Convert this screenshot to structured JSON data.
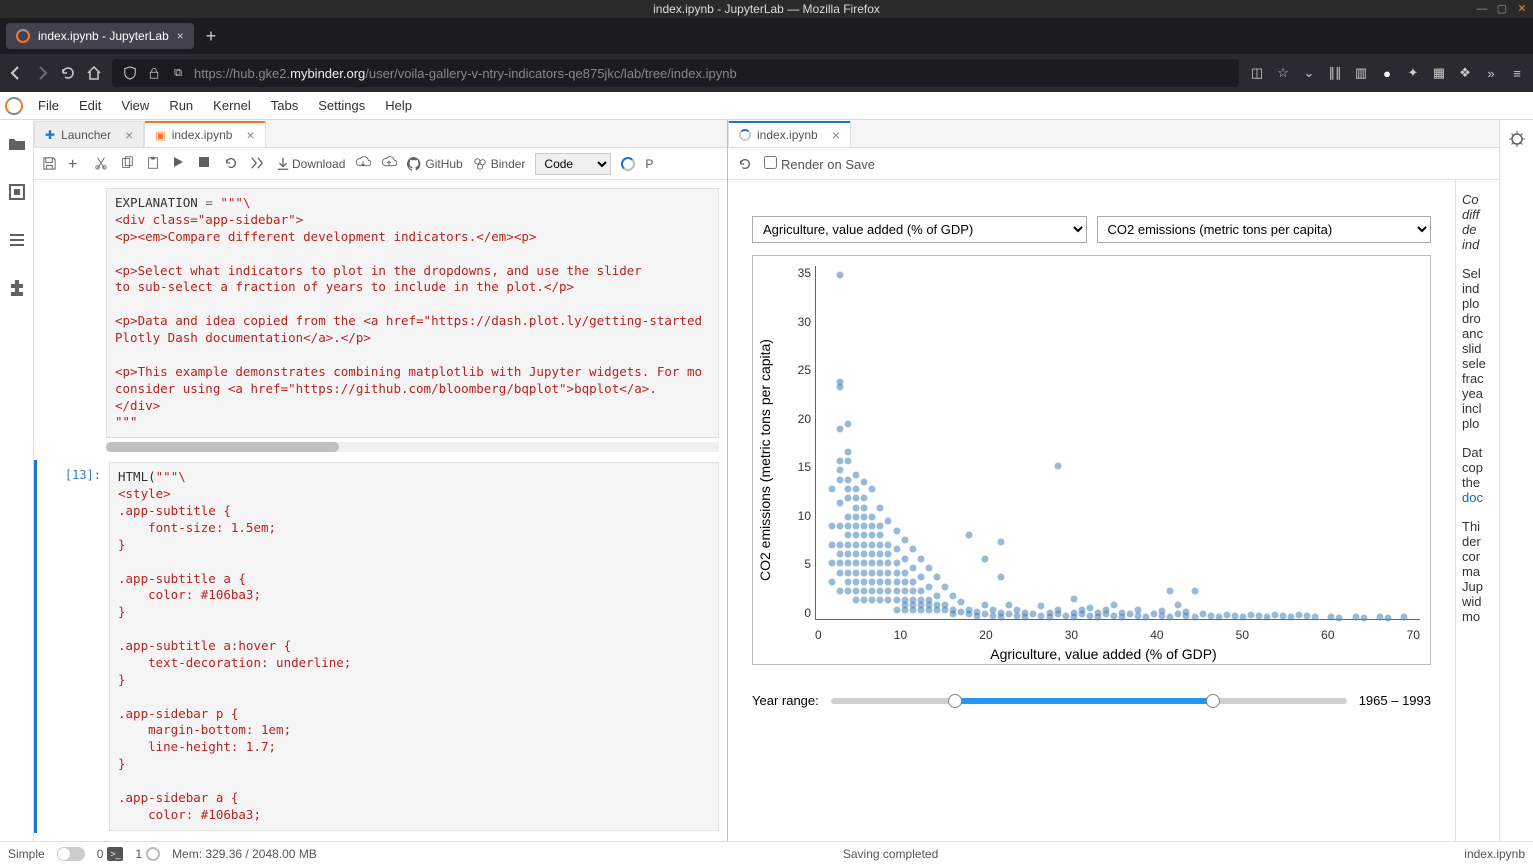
{
  "window": {
    "title": "index.ipynb - JupyterLab — Mozilla Firefox"
  },
  "firefox": {
    "tab_title": "index.ipynb - JupyterLab",
    "url_prefix": "https://hub.gke2.",
    "url_host": "mybinder.org",
    "url_path": "/user/voila-gallery-v-ntry-indicators-qe875jkc/lab/tree/index.ipynb"
  },
  "menubar": [
    "File",
    "Edit",
    "View",
    "Run",
    "Kernel",
    "Tabs",
    "Settings",
    "Help"
  ],
  "left_tabs": {
    "launcher": "Launcher",
    "notebook": "index.ipynb"
  },
  "nb_toolbar": {
    "download": "Download",
    "github": "GitHub",
    "binder": "Binder",
    "cell_type": "Code",
    "trusted_initial": "P"
  },
  "right_tabs": {
    "preview": "index.ipynb"
  },
  "preview_toolbar": {
    "render_on_save": "Render on Save"
  },
  "voila": {
    "select_x": "Agriculture, value added (% of GDP)",
    "select_y": "CO2 emissions (metric tons per capita)",
    "xlabel": "Agriculture, value added (% of GDP)",
    "ylabel": "CO2 emissions (metric tons per capita)",
    "year_label": "Year range:",
    "year_value": "1965 – 1993",
    "sidebar_lines": [
      "Co",
      "diff",
      "de",
      "ind",
      "",
      "Sel",
      "ind",
      "plo",
      "dro",
      "anc",
      "slid",
      "sele",
      "frac",
      "yea",
      "incl",
      "plo",
      "",
      "Dat",
      "cop",
      "the",
      "doc",
      "",
      "Thi",
      "der",
      "cor",
      "ma",
      "Jup",
      "wid",
      "mo"
    ]
  },
  "code_cell_1_prompt": "",
  "code_cell_1": "EXPLANATION = \"\"\"\\\n<div class=\"app-sidebar\">\n<p><em>Compare different development indicators.</em><p>\n\n<p>Select what indicators to plot in the dropdowns, and use the slider\nto sub-select a fraction of years to include in the plot.</p>\n\n<p>Data and idea copied from the <a href=\"https://dash.plot.ly/getting-started\nPlotly Dash documentation</a>.</p>\n\n<p>This example demonstrates combining matplotlib with Jupyter widgets. For mo\nconsider using <a href=\"https://github.com/bloomberg/bqplot\">bqplot</a>.\n</div>\n\"\"\"",
  "code_cell_2_prompt": "[13]:",
  "code_cell_2": "HTML(\"\"\"\\\n<style>\n.app-subtitle {\n    font-size: 1.5em;\n}\n\n.app-subtitle a {\n    color: #106ba3;\n}\n\n.app-subtitle a:hover {\n    text-decoration: underline;\n}\n\n.app-sidebar p {\n    margin-bottom: 1em;\n    line-height: 1.7;\n}\n\n.app-sidebar a {\n    color: #106ba3;",
  "chart_data": {
    "type": "scatter",
    "xlabel": "Agriculture, value added (% of GDP)",
    "ylabel": "CO2 emissions (metric tons per capita)",
    "xlim": [
      0,
      75
    ],
    "ylim": [
      0,
      38
    ],
    "x_ticks": [
      0,
      10,
      20,
      30,
      40,
      50,
      60,
      70
    ],
    "y_ticks": [
      0,
      5,
      10,
      15,
      20,
      25,
      30,
      35
    ],
    "points": [
      [
        3,
        37
      ],
      [
        3,
        25.5
      ],
      [
        3,
        25
      ],
      [
        4,
        21
      ],
      [
        3,
        20.5
      ],
      [
        4,
        18
      ],
      [
        3,
        17
      ],
      [
        4,
        17
      ],
      [
        3,
        16
      ],
      [
        5,
        15.5
      ],
      [
        4,
        15
      ],
      [
        3,
        15
      ],
      [
        6,
        14.8
      ],
      [
        5,
        14
      ],
      [
        4,
        14
      ],
      [
        7,
        14
      ],
      [
        6,
        13
      ],
      [
        5,
        13
      ],
      [
        4,
        13
      ],
      [
        3,
        12.5
      ],
      [
        8,
        12
      ],
      [
        6,
        12
      ],
      [
        5,
        12
      ],
      [
        7,
        11
      ],
      [
        6,
        11
      ],
      [
        5,
        11
      ],
      [
        4,
        11
      ],
      [
        9,
        10.5
      ],
      [
        8,
        10
      ],
      [
        7,
        10
      ],
      [
        6,
        10
      ],
      [
        5,
        10
      ],
      [
        4,
        10
      ],
      [
        3,
        10
      ],
      [
        10,
        9.5
      ],
      [
        19,
        9
      ],
      [
        8,
        9
      ],
      [
        7,
        9
      ],
      [
        6,
        9
      ],
      [
        5,
        9
      ],
      [
        4,
        9
      ],
      [
        11,
        8.5
      ],
      [
        9,
        8
      ],
      [
        8,
        8
      ],
      [
        7,
        8
      ],
      [
        6,
        8
      ],
      [
        5,
        8
      ],
      [
        4,
        8
      ],
      [
        3,
        8
      ],
      [
        12,
        7.5
      ],
      [
        10,
        7.5
      ],
      [
        9,
        7
      ],
      [
        8,
        7
      ],
      [
        7,
        7
      ],
      [
        6,
        7
      ],
      [
        5,
        7
      ],
      [
        4,
        7
      ],
      [
        3,
        7
      ],
      [
        21,
        6.5
      ],
      [
        13,
        6.5
      ],
      [
        11,
        6.5
      ],
      [
        10,
        6
      ],
      [
        9,
        6
      ],
      [
        8,
        6
      ],
      [
        7,
        6
      ],
      [
        6,
        6
      ],
      [
        5,
        6
      ],
      [
        4,
        6
      ],
      [
        3,
        6
      ],
      [
        14,
        5.5
      ],
      [
        12,
        5.5
      ],
      [
        11,
        5
      ],
      [
        10,
        5
      ],
      [
        9,
        5
      ],
      [
        8,
        5
      ],
      [
        7,
        5
      ],
      [
        6,
        5
      ],
      [
        5,
        5
      ],
      [
        4,
        5
      ],
      [
        3,
        5
      ],
      [
        23,
        4.5
      ],
      [
        15,
        4.5
      ],
      [
        13,
        4.5
      ],
      [
        12,
        4
      ],
      [
        11,
        4
      ],
      [
        10,
        4
      ],
      [
        9,
        4
      ],
      [
        8,
        4
      ],
      [
        7,
        4
      ],
      [
        6,
        4
      ],
      [
        5,
        4
      ],
      [
        4,
        4
      ],
      [
        16,
        3.5
      ],
      [
        14,
        3.5
      ],
      [
        13,
        3
      ],
      [
        12,
        3
      ],
      [
        11,
        3
      ],
      [
        10,
        3
      ],
      [
        9,
        3
      ],
      [
        8,
        3
      ],
      [
        7,
        3
      ],
      [
        6,
        3
      ],
      [
        5,
        3
      ],
      [
        4,
        3
      ],
      [
        3,
        3
      ],
      [
        47,
        3
      ],
      [
        44,
        3
      ],
      [
        17,
        2.5
      ],
      [
        15,
        2.5
      ],
      [
        14,
        2
      ],
      [
        13,
        2
      ],
      [
        12,
        2
      ],
      [
        11,
        2
      ],
      [
        10,
        2
      ],
      [
        9,
        2
      ],
      [
        8,
        2
      ],
      [
        7,
        2
      ],
      [
        6,
        2
      ],
      [
        5,
        2
      ],
      [
        18,
        1.8
      ],
      [
        16,
        1.5
      ],
      [
        15,
        1.5
      ],
      [
        14,
        1.5
      ],
      [
        13,
        1.5
      ],
      [
        12,
        1.5
      ],
      [
        11,
        1.5
      ],
      [
        21,
        1.5
      ],
      [
        24,
        1.5
      ],
      [
        28,
        1.4
      ],
      [
        17,
        1
      ],
      [
        16,
        1
      ],
      [
        15,
        1
      ],
      [
        14,
        1
      ],
      [
        13,
        1
      ],
      [
        12,
        1
      ],
      [
        11,
        1
      ],
      [
        10,
        1
      ],
      [
        19,
        1
      ],
      [
        22,
        1
      ],
      [
        25,
        1
      ],
      [
        30,
        1
      ],
      [
        33,
        1
      ],
      [
        36,
        1
      ],
      [
        18,
        0.8
      ],
      [
        20,
        0.8
      ],
      [
        23,
        0.7
      ],
      [
        26,
        0.7
      ],
      [
        29,
        0.7
      ],
      [
        32,
        0.7
      ],
      [
        35,
        0.6
      ],
      [
        38,
        0.6
      ],
      [
        17,
        0.5
      ],
      [
        19,
        0.5
      ],
      [
        21,
        0.5
      ],
      [
        24,
        0.5
      ],
      [
        27,
        0.5
      ],
      [
        30,
        0.5
      ],
      [
        33,
        0.5
      ],
      [
        36,
        0.5
      ],
      [
        39,
        0.5
      ],
      [
        42,
        0.5
      ],
      [
        45,
        0.5
      ],
      [
        48,
        0.5
      ],
      [
        51,
        0.4
      ],
      [
        54,
        0.4
      ],
      [
        57,
        0.4
      ],
      [
        60,
        0.4
      ],
      [
        20,
        0.3
      ],
      [
        22,
        0.3
      ],
      [
        25,
        0.3
      ],
      [
        28,
        0.3
      ],
      [
        31,
        0.3
      ],
      [
        34,
        0.3
      ],
      [
        37,
        0.3
      ],
      [
        40,
        0.3
      ],
      [
        43,
        0.3
      ],
      [
        46,
        0.3
      ],
      [
        49,
        0.3
      ],
      [
        52,
        0.3
      ],
      [
        55,
        0.3
      ],
      [
        58,
        0.3
      ],
      [
        61,
        0.3
      ],
      [
        64,
        0.2
      ],
      [
        67,
        0.2
      ],
      [
        70,
        0.2
      ],
      [
        73,
        0.2
      ],
      [
        23,
        0.2
      ],
      [
        26,
        0.2
      ],
      [
        29,
        0.2
      ],
      [
        32,
        0.2
      ],
      [
        35,
        0.2
      ],
      [
        38,
        0.2
      ],
      [
        41,
        0.2
      ],
      [
        44,
        0.2
      ],
      [
        47,
        0.2
      ],
      [
        50,
        0.2
      ],
      [
        53,
        0.2
      ],
      [
        56,
        0.2
      ],
      [
        59,
        0.2
      ],
      [
        62,
        0.2
      ],
      [
        65,
        0.15
      ],
      [
        68,
        0.15
      ],
      [
        71,
        0.15
      ],
      [
        30,
        16.5
      ],
      [
        23,
        8.3
      ],
      [
        32,
        2.2
      ],
      [
        34,
        1.2
      ],
      [
        37,
        1.5
      ],
      [
        40,
        1.0
      ],
      [
        43,
        0.9
      ],
      [
        46,
        0.8
      ],
      [
        45,
        1.5
      ],
      [
        2,
        14
      ],
      [
        2,
        10
      ],
      [
        2,
        8
      ],
      [
        2,
        6
      ],
      [
        2,
        4
      ]
    ]
  },
  "status": {
    "simple": "Simple",
    "terms": "0",
    "kernels": "1",
    "mem": "Mem: 329.36 / 2048.00 MB",
    "saving": "Saving completed",
    "path": "index.ipynb"
  }
}
